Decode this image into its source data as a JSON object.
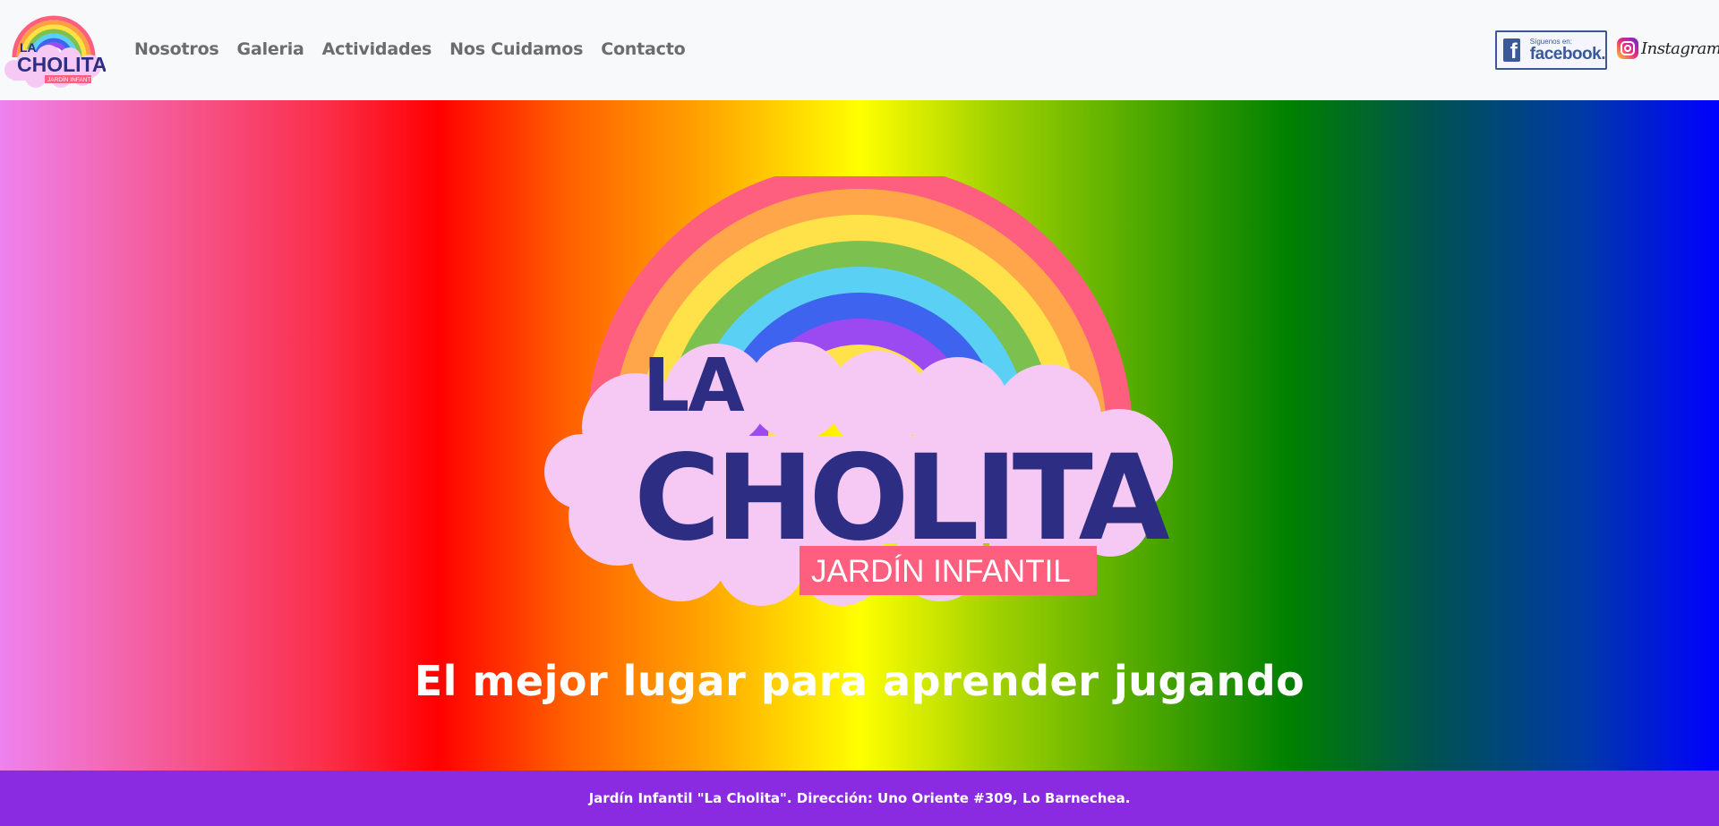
{
  "brand": {
    "name_top": "LA",
    "name_main": "CHOLITA",
    "subtitle": "JARDÍN INFANTIL"
  },
  "nav": {
    "items": [
      {
        "label": "Nosotros"
      },
      {
        "label": "Galeria"
      },
      {
        "label": "Actividades"
      },
      {
        "label": "Nos Cuidamos"
      },
      {
        "label": "Contacto"
      }
    ]
  },
  "social": {
    "facebook_small": "Síguenos en:",
    "facebook_big": "facebook.",
    "facebook_icon": "facebook-f-icon",
    "instagram_label": "Instagram",
    "instagram_icon": "instagram-icon"
  },
  "hero": {
    "tagline": "El mejor lugar para aprender jugando"
  },
  "footer": {
    "text": "Jardín Infantil \"La Cholita\". Dirección: Uno Oriente #309, Lo Barnechea."
  },
  "colors": {
    "navbar_bg": "#f8f9fa",
    "nav_text": "#6c6c6c",
    "footer_bg": "#8a2be2",
    "logo_text": "#2d2e83",
    "logo_ribbon": "#fe5f7e",
    "cloud": "#f5c9f3",
    "hero_gradient": [
      "#ee82ee",
      "#ff0000",
      "#ffa500",
      "#ffff00",
      "#008000",
      "#00534e",
      "#0000ff"
    ]
  }
}
